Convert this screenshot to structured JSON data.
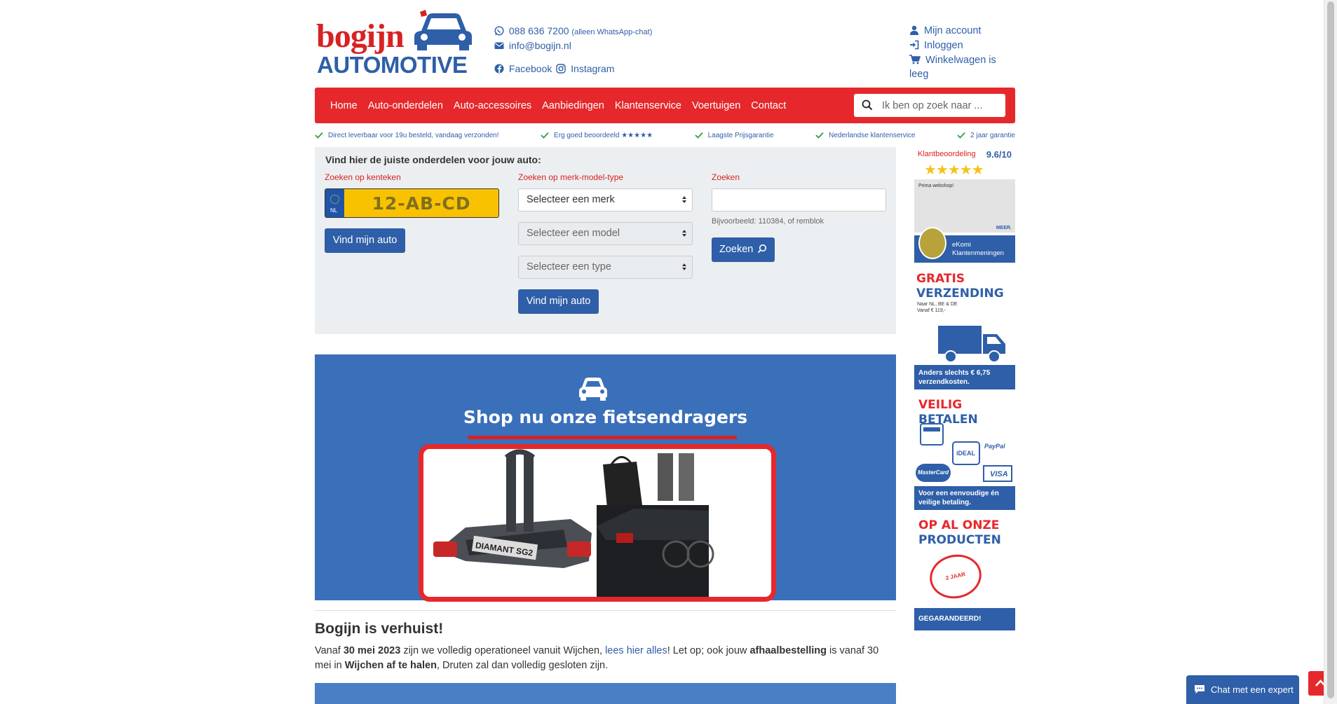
{
  "brand": {
    "logo_line1": "bogijn",
    "logo_line2": "AUTOMOTIVE"
  },
  "header": {
    "phone": "088 636 7200",
    "phone_note": "(alleen WhatsApp-chat)",
    "email": "info@bogijn.nl",
    "facebook": "Facebook",
    "instagram": "Instagram",
    "account": "Mijn account",
    "login": "Inloggen",
    "cart": "Winkelwagen is leeg"
  },
  "nav": {
    "items": [
      "Home",
      "Auto-onderdelen",
      "Auto-accessoires",
      "Aanbiedingen",
      "Klantenservice",
      "Voertuigen",
      "Contact"
    ],
    "search_placeholder": "Ik ben op zoek naar ..."
  },
  "usps": [
    "Direct leverbaar voor 19u besteld, vandaag verzonden!",
    "Erg goed beoordeeld ★★★★★",
    "Laagste Prijsgarantie",
    "Nederlandse klantenservice",
    "2 jaar garantie"
  ],
  "finder": {
    "title": "Vind hier de juiste onderdelen voor jouw auto:",
    "plate_label": "Zoeken op kenteken",
    "plate_country": "NL",
    "plate_value": "12-AB-CD",
    "plate_button": "Vind mijn auto",
    "mmt_label": "Zoeken op merk-model-type",
    "brand_select": "Selecteer een merk",
    "model_select": "Selecteer een model",
    "type_select": "Selecteer een type",
    "mmt_button": "Vind mijn auto",
    "search_label": "Zoeken",
    "search_hint": "Bijvoorbeeld: 110384, of remblok",
    "search_button": "Zoeken"
  },
  "banner": {
    "title": "Shop nu onze fietsendragers",
    "product_text": "DIAMANT SG2"
  },
  "news": {
    "title": "Bogijn is verhuist!",
    "p1": "Vanaf ",
    "date": "30 mei 2023",
    "p2": " zijn we volledig operationeel vanuit Wijchen, ",
    "link": "lees hier alles",
    "p3": "! Let op; ook jouw ",
    "b1": "afhaalbestelling",
    "p4": " is vanaf 30 mei in ",
    "b2": "Wijchen af te halen",
    "p5": ", Druten zal dan volledig gesloten zijn."
  },
  "sidebar": {
    "rating_label": "Klantbeoordeling",
    "rating_score": "9.6/10",
    "review_text": "Prima webshop!",
    "review_more": "MEER.",
    "ekomi": "eKomi",
    "ekomi_sub": "Klantenmeningen",
    "ship_title1": "GRATIS",
    "ship_title2": "VERZENDING",
    "ship_sub1": "Naar NL, BE & DE",
    "ship_sub2": "Vanaf € 119,-",
    "ship_strip1": "Anders slechts € 6,75",
    "ship_strip2": "verzendkosten.",
    "pay_title1": "VEILIG",
    "pay_title2": "BETALEN",
    "pay_logos": [
      "PayPal",
      "iDEAL",
      "MasterCard",
      "VISA"
    ],
    "pay_strip1": "Voor een eenvoudige én",
    "pay_strip2": "veilige betaling.",
    "guar_title1": "OP AL ONZE",
    "guar_title2": "PRODUCTEN",
    "guar_stamp": "2 JAAR GARANTIE",
    "guar_strip": "GEGARANDEERD!"
  },
  "chat": {
    "label": "Chat met een expert"
  },
  "colors": {
    "brand_red": "#e6282c",
    "brand_blue": "#2e5fa8",
    "plate_yellow": "#f9c200",
    "finder_bg": "#eceff1"
  }
}
